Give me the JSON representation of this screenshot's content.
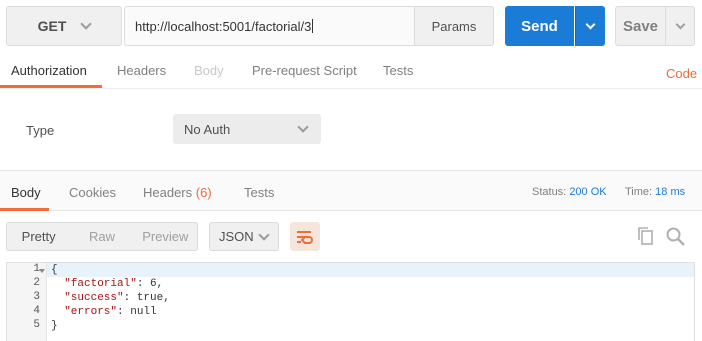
{
  "request": {
    "method": "GET",
    "url": "http://localhost:5001/factorial/3",
    "params_label": "Params",
    "send_label": "Send",
    "save_label": "Save"
  },
  "request_tabs": [
    {
      "label": "Authorization",
      "state": "active"
    },
    {
      "label": "Headers",
      "state": "normal"
    },
    {
      "label": "Body",
      "state": "disabled"
    },
    {
      "label": "Pre-request Script",
      "state": "normal"
    },
    {
      "label": "Tests",
      "state": "normal"
    }
  ],
  "code_link": "Code",
  "auth": {
    "type_label": "Type",
    "selected": "No Auth"
  },
  "response_tabs": {
    "body": "Body",
    "cookies": "Cookies",
    "headers": "Headers",
    "headers_count": "(6)",
    "tests": "Tests"
  },
  "response_status": {
    "status_label": "Status:",
    "status_value": "200 OK",
    "time_label": "Time:",
    "time_value": "18 ms"
  },
  "view": {
    "modes": [
      "Pretty",
      "Raw",
      "Preview"
    ],
    "active_mode": "Pretty",
    "format": "JSON"
  },
  "response_body": {
    "line_numbers": [
      "1",
      "2",
      "3",
      "4",
      "5"
    ],
    "lines": [
      "{",
      "  \"factorial\": 6,",
      "  \"success\": true,",
      "  \"errors\": null",
      "}"
    ]
  },
  "colors": {
    "accent": "#f26b3a",
    "primary": "#1b7cd8"
  }
}
